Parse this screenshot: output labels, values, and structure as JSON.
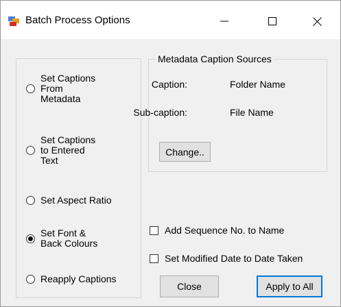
{
  "window": {
    "title": "Batch Process Options",
    "controls": {
      "minimize": "—",
      "maximize": "☐",
      "close": "✕"
    }
  },
  "options": [
    {
      "id": "from-metadata",
      "label": "Set Captions\nFrom\nMetadata",
      "checked": false
    },
    {
      "id": "entered-text",
      "label": "Set Captions\nto Entered\nText",
      "checked": false
    },
    {
      "id": "aspect-ratio",
      "label": "Set Aspect Ratio",
      "checked": false
    },
    {
      "id": "font-colours",
      "label": "Set Font &\nBack Colours",
      "checked": true
    },
    {
      "id": "reapply",
      "label": "Reapply Captions",
      "checked": false
    }
  ],
  "metadata": {
    "title": "Metadata Caption Sources",
    "caption_label": "Caption:",
    "caption_value": "Folder Name",
    "subcaption_label": "Sub-caption:",
    "subcaption_value": "File Name",
    "change_button": "Change.."
  },
  "checkboxes": {
    "sequence": {
      "label": "Add Sequence No. to Name",
      "checked": false
    },
    "modified_date": {
      "label": "Set Modified Date to Date Taken",
      "checked": false
    }
  },
  "buttons": {
    "close": "Close",
    "apply": "Apply to All"
  }
}
